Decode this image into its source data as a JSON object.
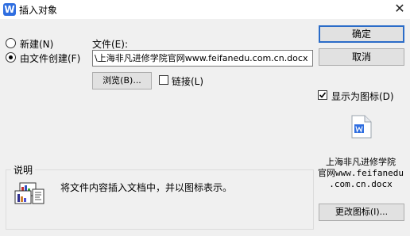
{
  "window": {
    "title": "插入对象",
    "close_glyph": "✕",
    "app_icon_letter": "W"
  },
  "options": {
    "new_label": "新建(N)",
    "from_file_label": "由文件创建(F)",
    "selected": "from_file"
  },
  "file": {
    "label": "文件(E):",
    "value": "\\上海非凡进修学院官网www.feifanedu.com.cn.docx",
    "browse_label": "浏览(B)...",
    "link_label": "链接(L)",
    "link_checked": false
  },
  "buttons": {
    "ok": "确定",
    "cancel": "取消",
    "change_icon": "更改图标(I)..."
  },
  "display_as_icon": {
    "label": "显示为图标(D)",
    "checked": true
  },
  "icon_preview": {
    "icon": "word-document-icon",
    "caption_line1": "上海非凡进修学院",
    "caption_line2": "官网www.feifanedu",
    "caption_line3": ".com.cn.docx"
  },
  "result": {
    "title": "说明",
    "text": "将文件内容插入文档中，并以图标表示。",
    "icon": "embedded-object-icon"
  },
  "colors": {
    "accent": "#2b6cc8",
    "app_icon": "#2f6ee0"
  }
}
